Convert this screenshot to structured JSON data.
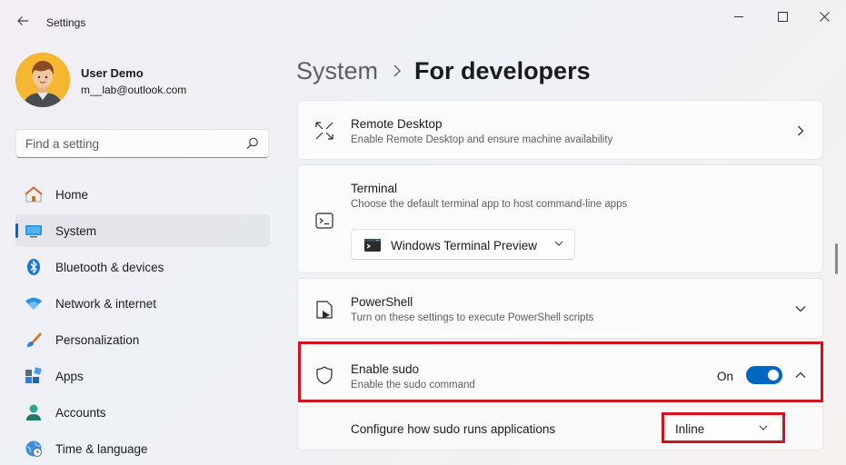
{
  "window": {
    "title": "Settings",
    "controls": [
      "minimize-icon",
      "maximize-icon",
      "close-icon"
    ]
  },
  "user": {
    "name": "User Demo",
    "email": "m__lab@outlook.com"
  },
  "search": {
    "placeholder": "Find a setting"
  },
  "sidebar": {
    "items": [
      {
        "label": "Home",
        "icon": "home-icon",
        "active": false
      },
      {
        "label": "System",
        "icon": "system-icon",
        "active": true
      },
      {
        "label": "Bluetooth & devices",
        "icon": "bluetooth-icon",
        "active": false
      },
      {
        "label": "Network & internet",
        "icon": "wifi-icon",
        "active": false
      },
      {
        "label": "Personalization",
        "icon": "brush-icon",
        "active": false
      },
      {
        "label": "Apps",
        "icon": "apps-icon",
        "active": false
      },
      {
        "label": "Accounts",
        "icon": "accounts-icon",
        "active": false
      },
      {
        "label": "Time & language",
        "icon": "globe-clock-icon",
        "active": false
      }
    ]
  },
  "breadcrumb": {
    "parent": "System",
    "current": "For developers"
  },
  "settings": {
    "remote_desktop": {
      "title": "Remote Desktop",
      "description": "Enable Remote Desktop and ensure machine availability"
    },
    "terminal": {
      "title": "Terminal",
      "description": "Choose the default terminal app to host command-line apps",
      "selected": "Windows Terminal Preview"
    },
    "powershell": {
      "title": "PowerShell",
      "description": "Turn on these settings to execute PowerShell scripts"
    },
    "sudo": {
      "title": "Enable sudo",
      "description": "Enable the sudo command",
      "state_label": "On",
      "enabled": true,
      "sub_label": "Configure how sudo runs applications",
      "mode": "Inline"
    }
  },
  "colors": {
    "accent": "#0067c0",
    "highlight": "#d0121e"
  }
}
